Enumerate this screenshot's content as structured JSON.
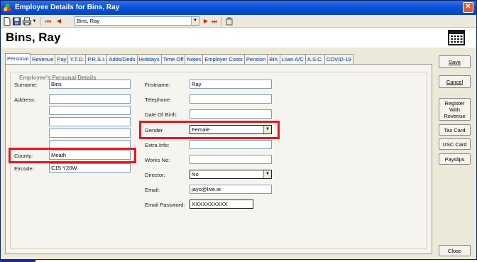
{
  "window": {
    "title": "Employee Details for Bins, Ray",
    "close_glyph": "✕"
  },
  "toolbar": {
    "combo_value": "Bins, Ray",
    "icons": [
      "new-icon",
      "save-icon",
      "print-icon",
      "first-record-icon",
      "previous-record-icon",
      "next-record-icon",
      "last-record-icon",
      "undo-icon"
    ]
  },
  "header": {
    "employee_name": "Bins, Ray"
  },
  "tabs": [
    "Personal",
    "Revenue",
    "Pay",
    "Y.T.D.",
    "P.R.S.I.",
    "Adds/Deds",
    "Holidays",
    "Time Off",
    "Notes",
    "Employer Costs",
    "Pension",
    "BIK",
    "Loan A/C",
    "A.S.C.",
    "COVID-19"
  ],
  "active_tab": "Personal",
  "group_title": "Employee's Personal Details",
  "left_form": {
    "surname_label": "Surname:",
    "surname_value": "Bins",
    "address_label": "Address:",
    "address_lines": [
      "",
      "",
      "",
      "",
      ""
    ],
    "county_label": "County:",
    "county_value": "Meath",
    "eircode_label": "Eircode:",
    "eircode_value": "C15 Y20W"
  },
  "right_form": {
    "firstname_label": "Firstname:",
    "firstname_value": "Ray",
    "telephone_label": "Telephone:",
    "telephone_value": "",
    "dob_label": "Date Of Birth:",
    "dob_value": "",
    "gender_label": "Gender",
    "gender_value": "Female",
    "extra_label": "Extra Info:",
    "extra_value": "",
    "works_label": "Works No:",
    "works_value": "",
    "director_label": "Director:",
    "director_value": "No",
    "email_label": "Email:",
    "email_value": "jayo@live.ie",
    "email_password_label": "Email Password:",
    "email_password_value": "XXXXXXXXXX"
  },
  "buttons": {
    "save": "Save",
    "cancel": "Cancel",
    "register_line1": "Register",
    "register_line2": "With",
    "register_line3": "Revenue",
    "tax_card": "Tax Card",
    "usc_card": "USC Card",
    "payslips": "Payslips",
    "close": "Close"
  },
  "colors": {
    "highlight": "#e8161c",
    "title_bar": "#0b52d8",
    "tab_text": "#0033a0"
  }
}
